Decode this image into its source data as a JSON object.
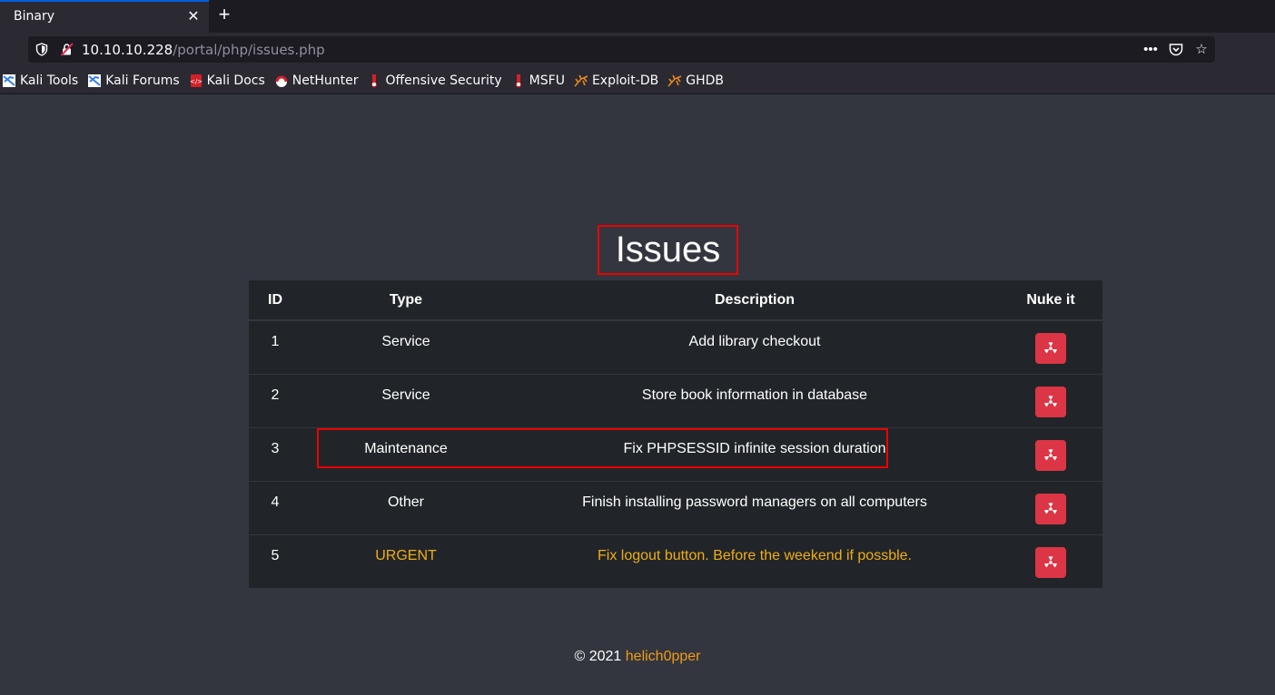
{
  "browser": {
    "tab_title": "Binary",
    "url_host": "10.10.10.228",
    "url_path": "/portal/php/issues.php",
    "bookmarks": [
      {
        "label": "Kali Tools",
        "icon": "kali-icon"
      },
      {
        "label": "Kali Forums",
        "icon": "kali-icon"
      },
      {
        "label": "Kali Docs",
        "icon": "kali-docs-icon"
      },
      {
        "label": "NetHunter",
        "icon": "nethunter-icon"
      },
      {
        "label": "Offensive Security",
        "icon": "offsec-icon"
      },
      {
        "label": "MSFU",
        "icon": "offsec-icon"
      },
      {
        "label": "Exploit-DB",
        "icon": "exploitdb-icon"
      },
      {
        "label": "GHDB",
        "icon": "exploitdb-icon"
      }
    ]
  },
  "page": {
    "heading": "Issues",
    "table": {
      "headers": [
        "ID",
        "Type",
        "Description",
        "Nuke it"
      ],
      "rows": [
        {
          "id": "1",
          "type": "Service",
          "description": "Add library checkout",
          "urgent": false
        },
        {
          "id": "2",
          "type": "Service",
          "description": "Store book information in database",
          "urgent": false
        },
        {
          "id": "3",
          "type": "Maintenance",
          "description": "Fix PHPSESSID infinite session duration",
          "urgent": false
        },
        {
          "id": "4",
          "type": "Other",
          "description": "Finish installing password managers on all computers",
          "urgent": false
        },
        {
          "id": "5",
          "type": "URGENT",
          "description": "Fix logout button. Before the weekend if possble.",
          "urgent": true
        }
      ]
    },
    "footer": {
      "copyright": "© 2021",
      "author": "helich0pper"
    }
  },
  "colors": {
    "background": "#33363e",
    "table_bg": "#212529",
    "danger": "#dc3545",
    "urgent_text": "#f0ad15",
    "highlight": "#e00000"
  }
}
